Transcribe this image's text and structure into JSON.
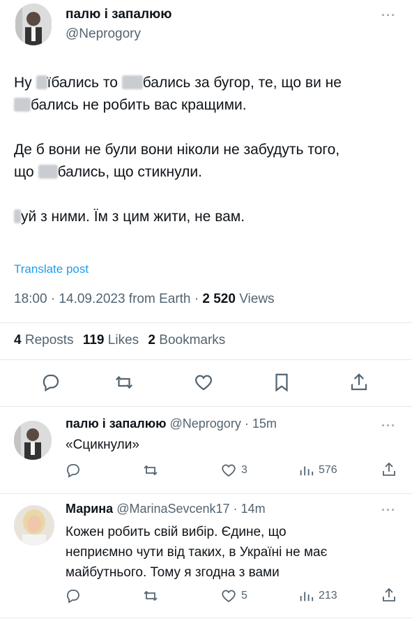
{
  "main_post": {
    "author_name": "палю і запалюю",
    "author_handle": "@Neprogory",
    "paragraphs": [
      {
        "line1a": "Ну ",
        "line1b": "їбались то ",
        "line1c": "бались за бугор, те, що ви не",
        "line2": "бались не робить вас кращими."
      },
      {
        "line1": "Де б вони не були вони ніколи не забудуть того,",
        "line2a": "що ",
        "line2b": "бались, що стикнули."
      },
      {
        "line1": "уй з ними. Їм з цим жити, не вам."
      }
    ],
    "translate_label": "Translate post",
    "meta": {
      "time_date": "18:00 · 14.09.2023 from Earth · ",
      "views_count": "2 520",
      "views_label": " Views"
    },
    "stats": {
      "reposts_count": "4",
      "reposts_label": " Reposts",
      "likes_count": "119",
      "likes_label": " Likes",
      "bookmarks_count": "2",
      "bookmarks_label": " Bookmarks"
    }
  },
  "replies": [
    {
      "author_name": "палю і запалюю",
      "author_handle": "@Neprogory",
      "time": " · 15m",
      "text_lines": [
        "«Сцикнули»"
      ],
      "likes": "3",
      "views": "576"
    },
    {
      "author_name": "Марина",
      "author_handle": "@MarinaSevcenk17",
      "time": " · 14m",
      "text_lines": [
        "Кожен робить свій вибір. Єдине, що",
        "неприємно чути від таких, в Україні не має",
        "майбутнього. Тому я згодна з вами"
      ],
      "likes": "5",
      "views": "213"
    }
  ],
  "icons": {
    "more": "more-icon",
    "reply": "reply-icon",
    "repost": "repost-icon",
    "like": "heart-icon",
    "bookmark": "bookmark-icon",
    "share": "share-icon",
    "views": "views-icon"
  },
  "colors": {
    "link": "#1d9bf0",
    "muted": "#536471",
    "text": "#0f1419"
  }
}
